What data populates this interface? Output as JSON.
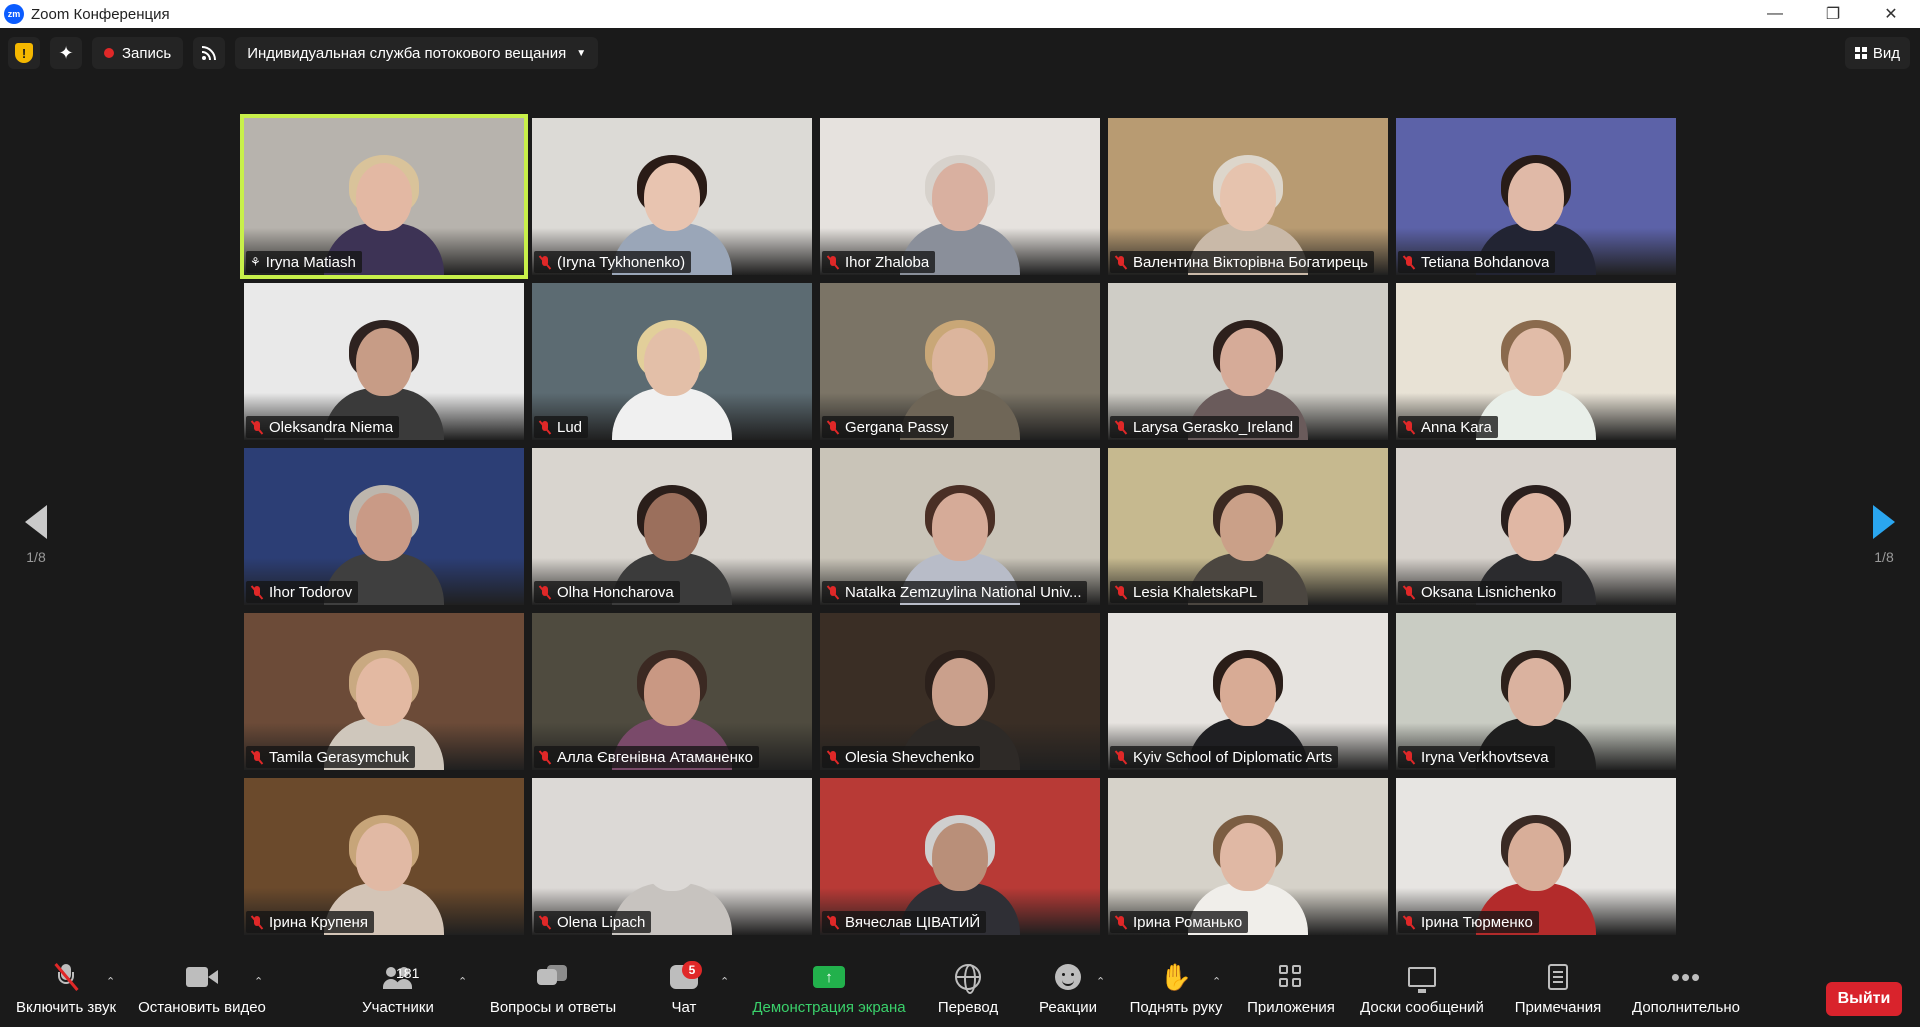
{
  "window": {
    "app_logo": "zm",
    "title": "Zoom Конференция",
    "controls": [
      "minimize-icon",
      "restore-icon",
      "close-icon"
    ]
  },
  "toolbar": {
    "record_label": "Запись",
    "stream_label": "Индивидуальная служба потокового вещания",
    "view_label": "Вид"
  },
  "pager": {
    "left": "1/8",
    "right": "1/8"
  },
  "participants": [
    {
      "name": "Iryna Matiash",
      "active": true,
      "pinned": true,
      "bg": "#b7b3ad",
      "skin": "#e3b8a3",
      "hair": "#d9c39a",
      "body": "#3d3355"
    },
    {
      "name": "(Iryna Tykhonenko)",
      "bg": "#dcdad6",
      "skin": "#e8c4b0",
      "hair": "#2a1b16",
      "body": "#9aa6b8"
    },
    {
      "name": "Ihor Zhaloba",
      "bg": "#e6e2de",
      "skin": "#d9b0a0",
      "hair": "#d7d2cc",
      "body": "#8a8f9a"
    },
    {
      "name": "Валентина Вікторівна Богатирець",
      "bg": "#b89b72",
      "skin": "#e6c3ae",
      "hair": "#ddd6cb",
      "body": "#c9b9a8"
    },
    {
      "name": "Tetiana Bohdanova",
      "bg": "#5c62a8",
      "skin": "#e0b9a7",
      "hair": "#281c18",
      "body": "#222433"
    },
    {
      "name": "Oleksandra Niema",
      "bg": "#e9e9e9",
      "skin": "#c79c86",
      "hair": "#2e2220",
      "body": "#3a3a3a"
    },
    {
      "name": "Lud",
      "bg": "#5c6b72",
      "skin": "#e3bfa8",
      "hair": "#e2cf9a",
      "body": "#f0f0f0"
    },
    {
      "name": "Gergana Passy",
      "bg": "#7b7466",
      "skin": "#dcb59d",
      "hair": "#c9a777",
      "body": "#6f6657"
    },
    {
      "name": "Larysa Gerasko_Ireland",
      "bg": "#cfcdc6",
      "skin": "#d6ab98",
      "hair": "#2d201c",
      "body": "#6a5b5b"
    },
    {
      "name": "Anna Kara",
      "bg": "#e8e2d5",
      "skin": "#e1bca8",
      "hair": "#8a6a4d",
      "body": "#e9efe9"
    },
    {
      "name": "Ihor Todorov",
      "bg": "#2c3e75",
      "skin": "#c99a86",
      "hair": "#bdb6ad",
      "body": "#3f3f3f"
    },
    {
      "name": "Olha Honcharova",
      "bg": "#d9d5cf",
      "skin": "#9b6f5c",
      "hair": "#2a1e1a",
      "body": "#3b3b3b"
    },
    {
      "name": "Natalka Zemzuylina National Univ...",
      "bg": "#c9c4b8",
      "skin": "#d6ab98",
      "hair": "#4a2f25",
      "body": "#b8bcc8"
    },
    {
      "name": "Lesia KhaletskaPL",
      "bg": "#c6b98f",
      "skin": "#caa088",
      "hair": "#3c2a22",
      "body": "#4b4640"
    },
    {
      "name": "Oksana Lisnichenko",
      "bg": "#d7d2cc",
      "skin": "#e0b7a4",
      "hair": "#2a1f1d",
      "body": "#2b2b2e"
    },
    {
      "name": "Tamila Gerasymchuk",
      "bg": "#6c4b38",
      "skin": "#e3b9a2",
      "hair": "#c9a981",
      "body": "#cfc7bc"
    },
    {
      "name": "Алла Євгенівна Атаманенко",
      "bg": "#4f4b3f",
      "skin": "#c99883",
      "hair": "#3b2922",
      "body": "#7a4a6a"
    },
    {
      "name": "Olesia Shevchenko",
      "bg": "#3a2e25",
      "skin": "#caa08c",
      "hair": "#2b201b",
      "body": "#2e2a27"
    },
    {
      "name": "Kyiv School of Diplomatic Arts",
      "bg": "#e6e3df",
      "skin": "#d8ab95",
      "hair": "#2a1d18",
      "body": "#1f1f22"
    },
    {
      "name": "Iryna Verkhovtseva",
      "bg": "#c9ccc3",
      "skin": "#dab29f",
      "hair": "#2d211b",
      "body": "#1e1e1e"
    },
    {
      "name": "Ірина Крупеня",
      "bg": "#6b4a2c",
      "skin": "#e1b9a4",
      "hair": "#c7a579",
      "body": "#d3c4b6"
    },
    {
      "name": "Olena Lipach",
      "bg": "#dcd9d6",
      "skin": "#dcd9d6",
      "hair": "#dcd9d6",
      "body": "#c7c3bf"
    },
    {
      "name": "Вячеслав ЦІВАТИЙ",
      "bg": "#b83a36",
      "skin": "#b98f79",
      "hair": "#cfcfcf",
      "body": "#2f2f35"
    },
    {
      "name": "Ірина Романько",
      "bg": "#d6d2c9",
      "skin": "#e0b8a4",
      "hair": "#7b5d42",
      "body": "#f0eeea"
    },
    {
      "name": "Ірина Тюрменко",
      "bg": "#e7e5e2",
      "skin": "#d8ae99",
      "hair": "#3a2a24",
      "body": "#b32b2b"
    }
  ],
  "controls": {
    "unmute": "Включить звук",
    "stop_video": "Остановить видео",
    "participants": "Участники",
    "participants_count": "181",
    "qa": "Вопросы и ответы",
    "chat": "Чат",
    "chat_badge": "5",
    "share": "Демонстрация экрана",
    "translate": "Перевод",
    "reactions": "Реакции",
    "raise_hand": "Поднять руку",
    "apps": "Приложения",
    "whiteboards": "Доски сообщений",
    "notes": "Примечания",
    "more": "Дополнительно",
    "leave": "Выйти"
  },
  "colors": {
    "active_speaker_border": "#c8f04a",
    "muted_red": "#e02828",
    "share_green": "#22b14c",
    "leave_red": "#d9232c",
    "next_arrow_blue": "#2aa6f0"
  }
}
